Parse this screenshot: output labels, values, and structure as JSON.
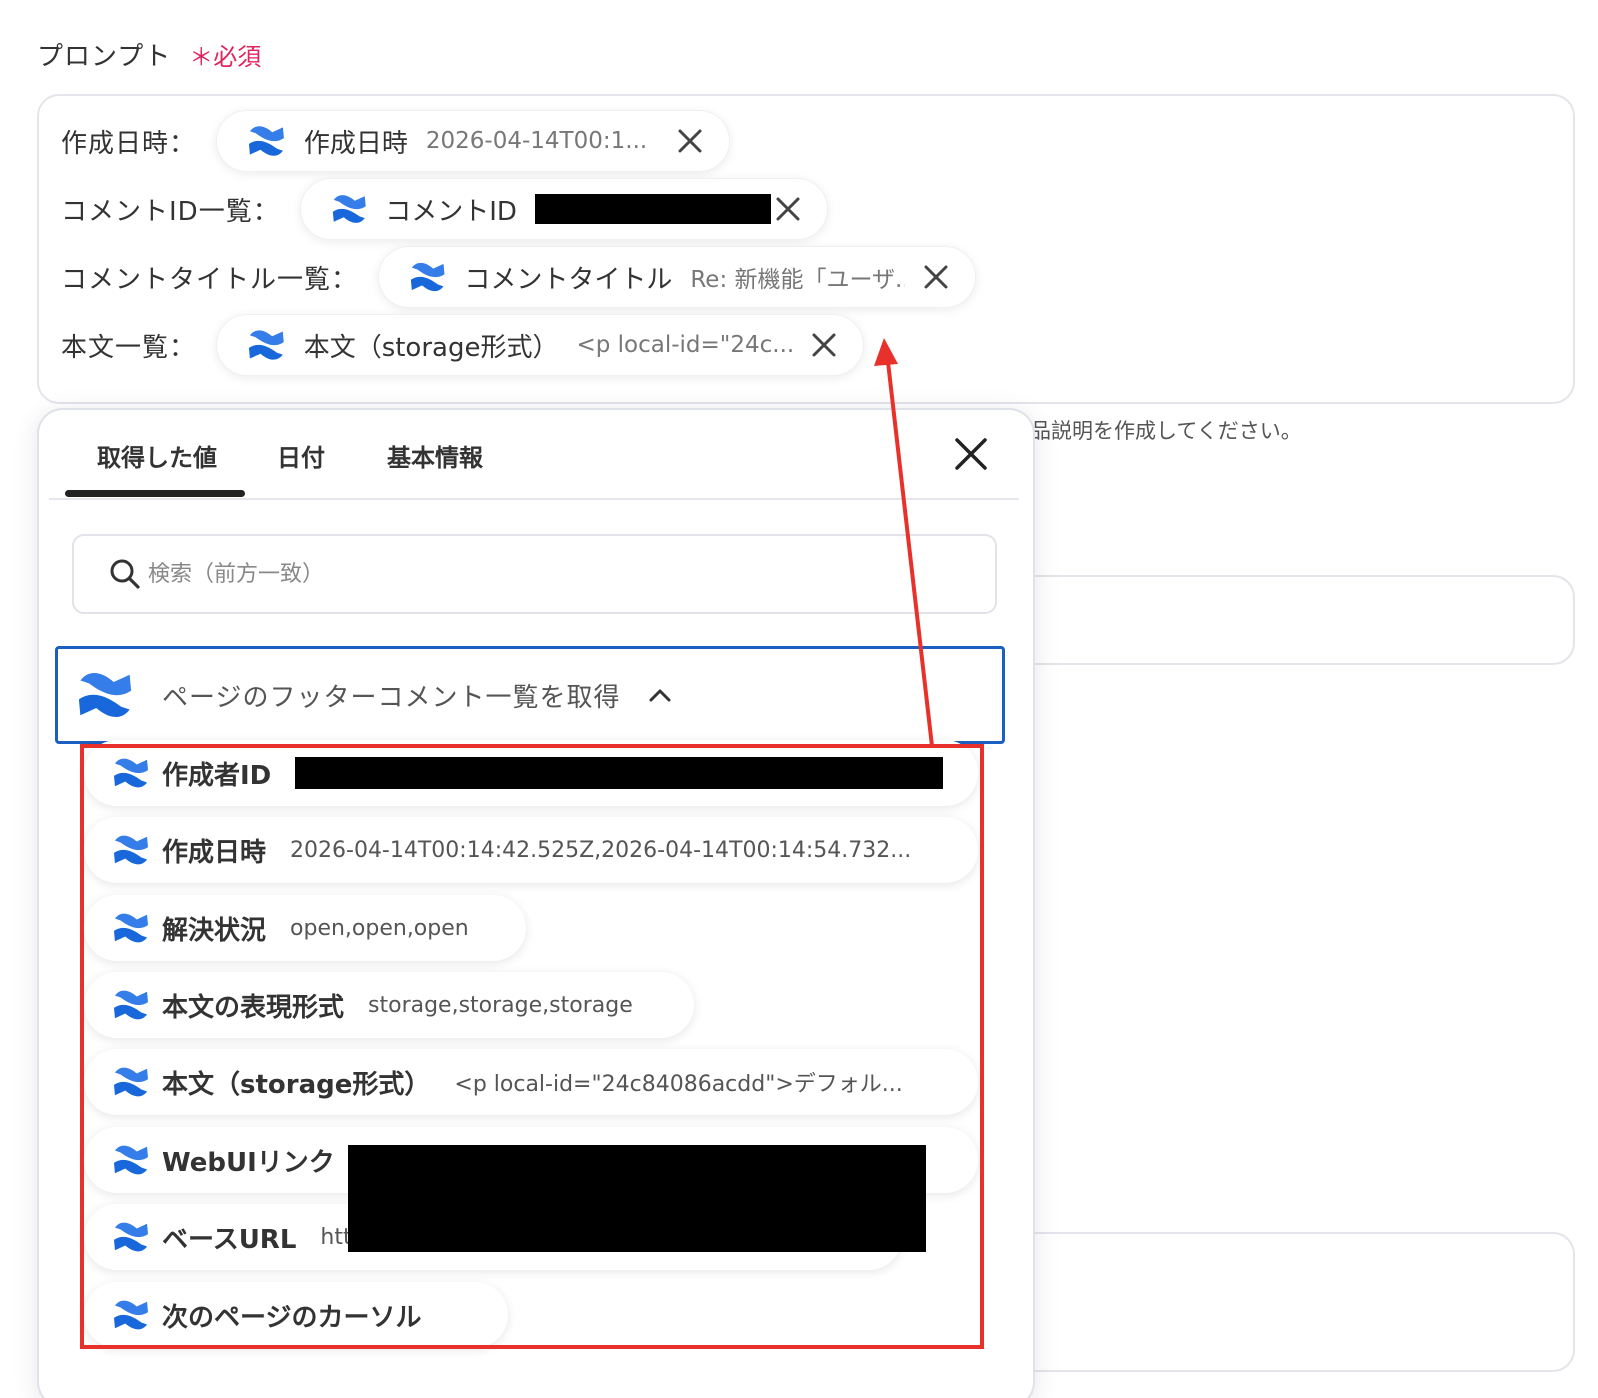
{
  "field": {
    "label": "プロンプト",
    "required": "＊必須"
  },
  "prompt_lines": [
    {
      "key": "作成日時：",
      "chip_name": "作成日時",
      "chip_value": "2026-04-14T00:1..."
    },
    {
      "key": "コメントID一覧：",
      "chip_name": "コメントID",
      "chip_value": ""
    },
    {
      "key": "コメントタイトル一覧：",
      "chip_name": "コメントタイトル",
      "chip_value": "Re: 新機能「ユーザ..."
    },
    {
      "key": "本文一覧：",
      "chip_name": "本文（storage形式）",
      "chip_value": "<p local-id=\"24c..."
    }
  ],
  "background_hint": "品説明を作成してください。",
  "panel": {
    "tabs": [
      "取得した値",
      "日付",
      "基本情報"
    ],
    "active_tab": 0,
    "search_placeholder": "検索（前方一致）",
    "group_title": "ページのフッターコメント一覧を取得",
    "items": [
      {
        "name": "作成者ID",
        "value": ""
      },
      {
        "name": "作成日時",
        "value": "2026-04-14T00:14:42.525Z,2026-04-14T00:14:54.732..."
      },
      {
        "name": "解決状況",
        "value": "open,open,open"
      },
      {
        "name": "本文の表現形式",
        "value": "storage,storage,storage"
      },
      {
        "name": "本文（storage形式）",
        "value": "<p local-id=\"24c84086acdd\">デフォル..."
      },
      {
        "name": "WebUIリンク",
        "value": ""
      },
      {
        "name": "ベースURL",
        "value": "htt"
      },
      {
        "name": "次のページのカーソル",
        "value": ""
      }
    ]
  },
  "colors": {
    "accent": "#1b5fc2",
    "required": "#e0245e",
    "highlight": "#e8312a",
    "logo_dark": "#1868db",
    "logo_light": "#357de8"
  },
  "icons": [
    "confluence-logo-icon",
    "close-icon",
    "search-icon",
    "chevron-up-icon"
  ]
}
